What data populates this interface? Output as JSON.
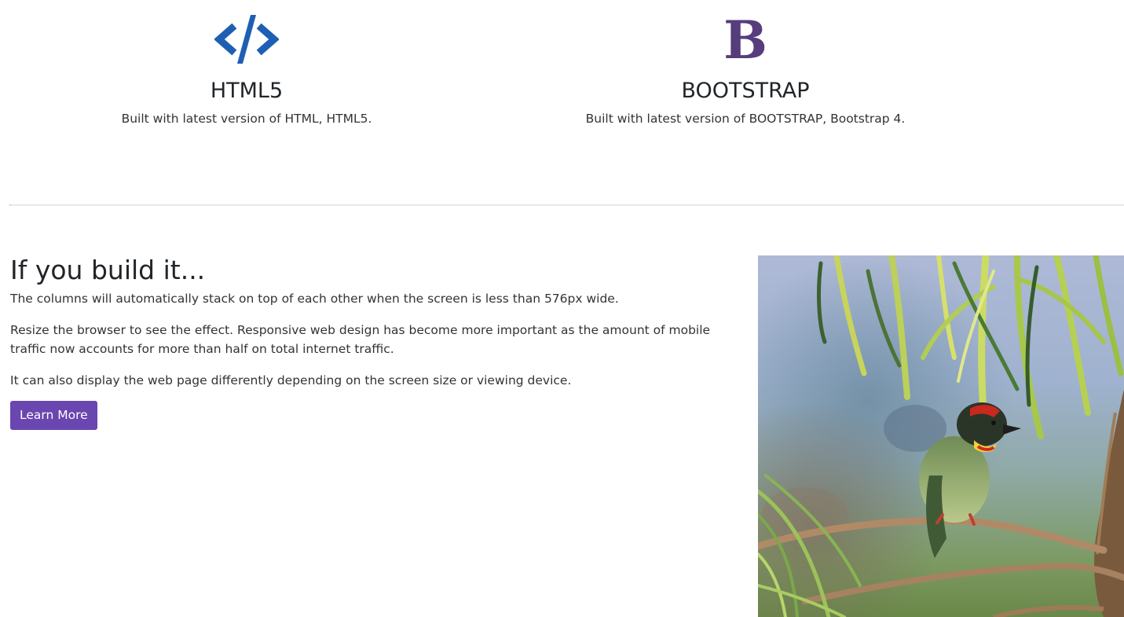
{
  "features": [
    {
      "title": "HTML5",
      "desc": "Built with latest version of HTML, HTML5.",
      "icon": "code-icon",
      "color": "#1e5fb4"
    },
    {
      "title": "BOOTSTRAP",
      "desc": "Built with latest version of BOOTSTRAP, Bootstrap 4.",
      "icon": "bootstrap-icon",
      "color": "#563d7c"
    }
  ],
  "intro": {
    "heading": "If you build it...",
    "paragraphs": [
      "The columns will automatically stack on top of each other when the screen is less than 576px wide.",
      "Resize the browser to see the effect. Responsive web design has become more important as the amount of mobile traffic now accounts for more than half on total internet traffic.",
      "It can also display the web page differently depending on the screen size or viewing device."
    ],
    "button_label": "Learn More",
    "button_color": "#6a46b0"
  },
  "bootstrap_glyph": "B"
}
